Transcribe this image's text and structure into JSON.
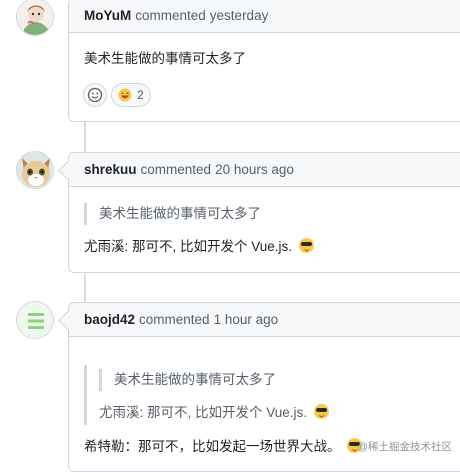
{
  "comments": [
    {
      "author": "MoYuM",
      "action": "commented",
      "time": "yesterday",
      "body": "美术生能做的事情可太多了",
      "reactions": [
        {
          "emoji": "smiley-add",
          "count": ""
        },
        {
          "emoji": "laugh",
          "count": "2"
        }
      ]
    },
    {
      "author": "shrekuu",
      "action": "commented",
      "time": "20 hours ago",
      "quote": "美术生能做的事情可太多了",
      "body": "尤雨溪: 那可不, 比如开发个 Vue.js."
    },
    {
      "author": "baojd42",
      "action": "commented",
      "time": "1 hour ago",
      "nested_quote": "美术生能做的事情可太多了",
      "quote": "尤雨溪: 那可不, 比如开发个 Vue.js.",
      "body": "希特勒：那可不，比如发起一场世界大战。"
    }
  ],
  "icons": {
    "reaction_add": "smiley-icon",
    "cool_emoji": "sunglasses-emoji"
  },
  "watermark": "@稀土掘金技术社区"
}
